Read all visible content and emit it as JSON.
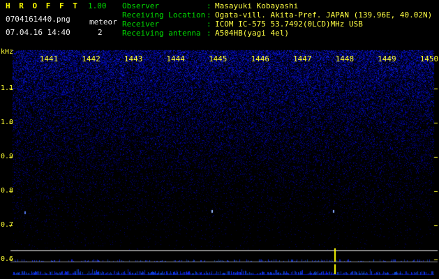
{
  "header": {
    "app_name": "H R O F F T",
    "version": "1.00",
    "filename": "0704161440.png",
    "mode_label": "meteor",
    "meteor_count": "2",
    "datetime": "07.04.16 14:40",
    "colon": ":",
    "info": [
      {
        "label": "Observer",
        "value": "Masayuki Kobayashi"
      },
      {
        "label": "Receiving Location",
        "value": "Ogata-vill. Akita-Pref. JAPAN (139.96E, 40.02N)"
      },
      {
        "label": "Receiver",
        "value": "ICOM IC-575 53.7492(0LCD)MHz USB"
      },
      {
        "label": "Receiving antenna",
        "value": "A504HB(yagi 4el)"
      }
    ]
  },
  "chart_data": {
    "type": "heatmap",
    "title": "",
    "description": "Radio meteor observation spectrogram: blue background noise fading downward, signal-level strip below, meteor echo spike near 14:48",
    "y_unit_label": "kHz",
    "y_ticks": [
      "1.1",
      "1.0",
      "0.9",
      "0.8",
      "0.7",
      "0.6"
    ],
    "x_ticks": [
      "1441",
      "1442",
      "1443",
      "1444",
      "1445",
      "1446",
      "1447",
      "1448",
      "1449",
      "1450"
    ],
    "y_range_khz": [
      0.6,
      1.2
    ],
    "events": [
      {
        "kind": "meteor-spike",
        "near_time": "1448",
        "x_frac": 0.763,
        "color": "#ffff00"
      },
      {
        "kind": "echo-dot",
        "x_frac": 0.028,
        "y_khz": 0.74,
        "color": "#5577ee"
      },
      {
        "kind": "echo-dot",
        "x_frac": 0.472,
        "y_khz": 0.745,
        "color": "#99bbff"
      },
      {
        "kind": "echo-dot",
        "x_frac": 0.76,
        "y_khz": 0.745,
        "color": "#88aaff"
      }
    ],
    "colors": {
      "background": "#000000",
      "axis_tick": "#ffff33",
      "noise_base": "#0000cc",
      "level_line_bright": "#e0e0e0",
      "level_line_dim": "#909090"
    }
  }
}
